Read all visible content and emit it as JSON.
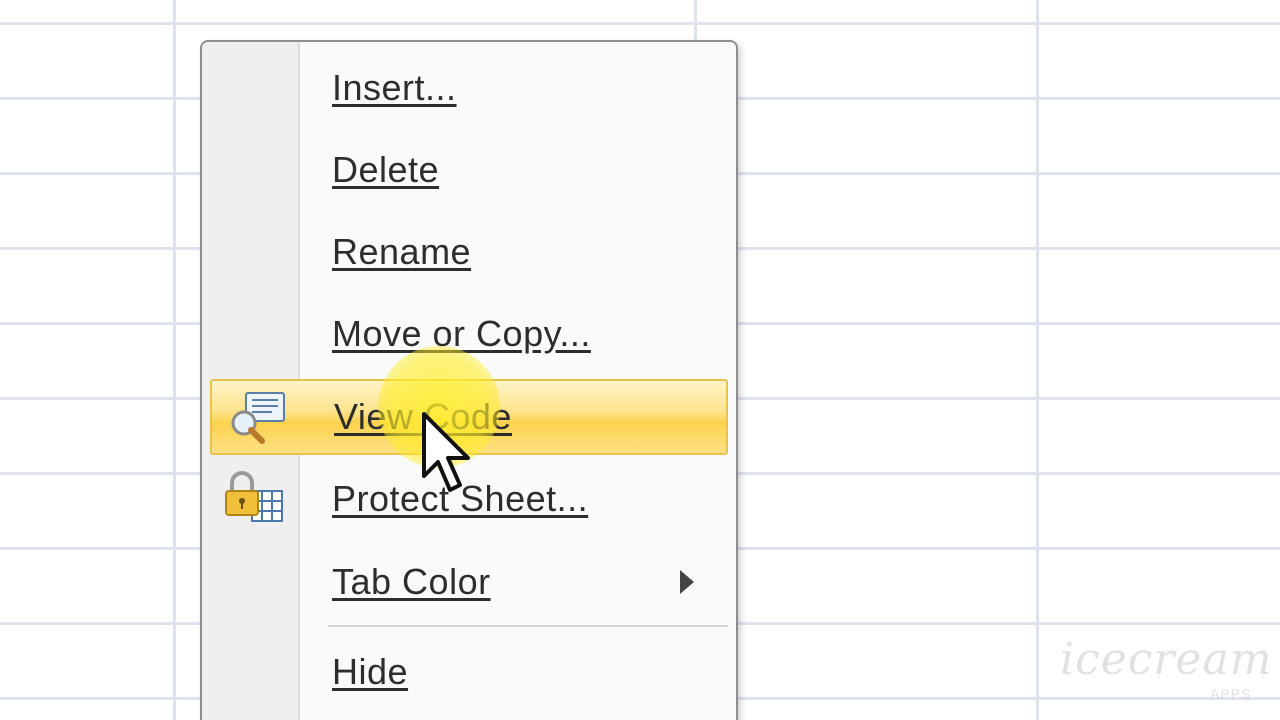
{
  "context_menu": {
    "items": [
      {
        "label": "Insert..."
      },
      {
        "label": "Delete"
      },
      {
        "label": "Rename"
      },
      {
        "label": "Move or Copy..."
      },
      {
        "label": "View Code",
        "icon": "view-code-icon",
        "highlighted": true
      },
      {
        "label": "Protect Sheet...",
        "icon": "protect-sheet-icon"
      },
      {
        "label": "Tab Color",
        "has_submenu": true
      },
      {
        "label": "Hide"
      }
    ]
  },
  "watermark": {
    "text": "icecream",
    "subtext": "APPS"
  },
  "colors": {
    "highlight": "#fbd24e",
    "grid": "#dfe3ee",
    "gutter": "#efefef"
  }
}
